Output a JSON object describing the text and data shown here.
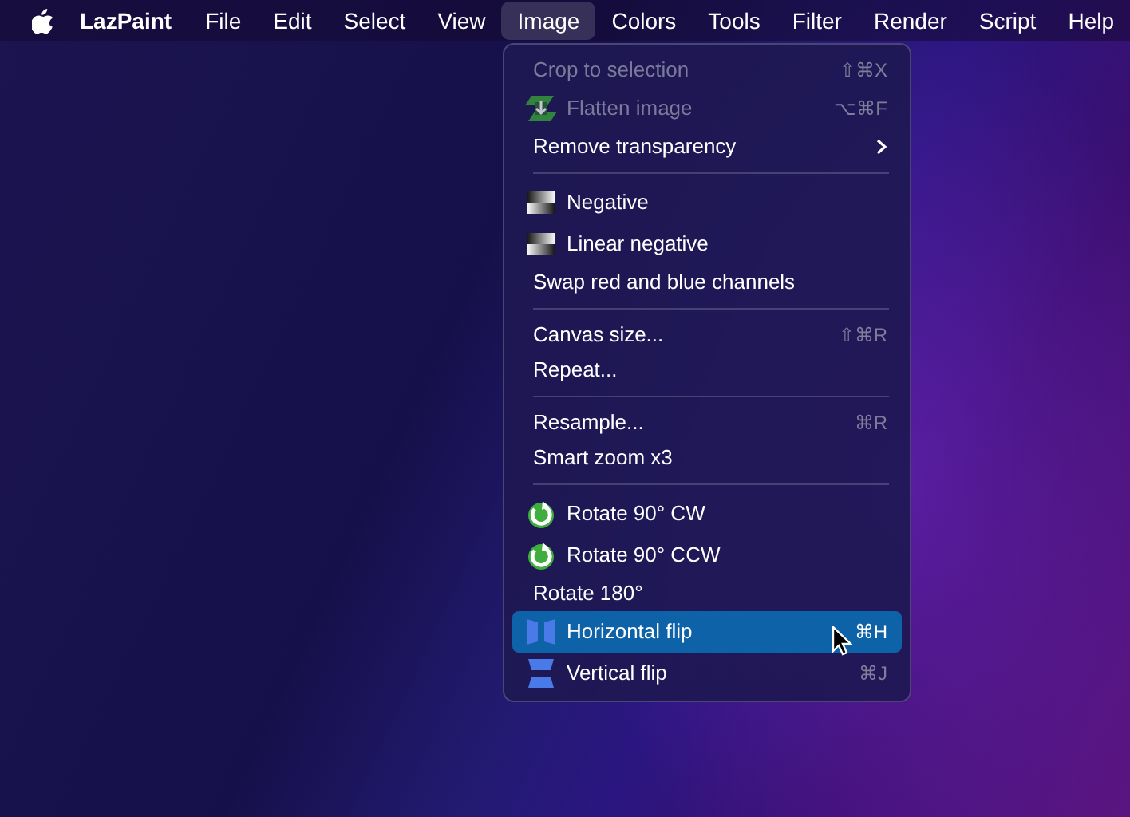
{
  "menubar": {
    "app_name": "LazPaint",
    "items": [
      {
        "label": "File",
        "selected": false
      },
      {
        "label": "Edit",
        "selected": false
      },
      {
        "label": "Select",
        "selected": false
      },
      {
        "label": "View",
        "selected": false
      },
      {
        "label": "Image",
        "selected": true
      },
      {
        "label": "Colors",
        "selected": false
      },
      {
        "label": "Tools",
        "selected": false
      },
      {
        "label": "Filter",
        "selected": false
      },
      {
        "label": "Render",
        "selected": false
      },
      {
        "label": "Script",
        "selected": false
      },
      {
        "label": "Help",
        "selected": false
      }
    ]
  },
  "menu": {
    "items": [
      {
        "kind": "item",
        "label": "Crop to selection",
        "shortcut": "⇧⌘X",
        "disabled": true,
        "selected": false
      },
      {
        "kind": "item",
        "label": "Flatten image",
        "shortcut": "⌥⌘F",
        "disabled": true,
        "selected": false
      },
      {
        "kind": "item",
        "label": "Remove transparency",
        "submenu": true,
        "disabled": false,
        "selected": false
      },
      {
        "kind": "separator"
      },
      {
        "kind": "item",
        "label": "Negative",
        "disabled": false,
        "selected": false
      },
      {
        "kind": "item",
        "label": "Linear negative",
        "disabled": false,
        "selected": false
      },
      {
        "kind": "item",
        "label": "Swap red and blue channels",
        "disabled": false,
        "selected": false
      },
      {
        "kind": "separator"
      },
      {
        "kind": "item",
        "label": "Canvas size...",
        "shortcut": "⇧⌘R",
        "disabled": false,
        "selected": false
      },
      {
        "kind": "item",
        "label": "Repeat...",
        "disabled": false,
        "selected": false
      },
      {
        "kind": "separator"
      },
      {
        "kind": "item",
        "label": "Resample...",
        "shortcut": "⌘R",
        "disabled": false,
        "selected": false
      },
      {
        "kind": "item",
        "label": "Smart zoom x3",
        "disabled": false,
        "selected": false
      },
      {
        "kind": "separator"
      },
      {
        "kind": "item",
        "label": "Rotate 90° CW",
        "disabled": false,
        "selected": false
      },
      {
        "kind": "item",
        "label": "Rotate 90° CCW",
        "disabled": false,
        "selected": false
      },
      {
        "kind": "item",
        "label": "Rotate 180°",
        "disabled": false,
        "selected": false
      },
      {
        "kind": "item",
        "label": "Horizontal flip",
        "shortcut": "⌘H",
        "disabled": false,
        "selected": true
      },
      {
        "kind": "item",
        "label": "Vertical flip",
        "shortcut": "⌘J",
        "disabled": false,
        "selected": false
      }
    ]
  }
}
